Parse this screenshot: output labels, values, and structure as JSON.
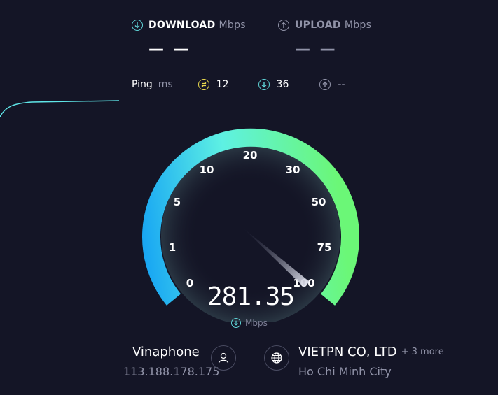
{
  "download": {
    "label": "DOWNLOAD",
    "unit": "Mbps",
    "value": "— —"
  },
  "upload": {
    "label": "UPLOAD",
    "unit": "Mbps",
    "value": "— —"
  },
  "ping": {
    "label": "Ping",
    "unit": "ms",
    "idle": "12",
    "download": "36",
    "upload": "--"
  },
  "gauge": {
    "ticks": [
      "0",
      "1",
      "5",
      "10",
      "20",
      "30",
      "50",
      "75",
      "100"
    ],
    "value": "281.35",
    "unit": "Mbps",
    "needle_level": 1.0
  },
  "isp": {
    "name": "Vinaphone",
    "ip": "113.188.178.175"
  },
  "server": {
    "name": "VIETPN CO, LTD",
    "more": "+ 3 more",
    "location": "Ho Chi Minh City"
  },
  "colors": {
    "background": "#141526",
    "gauge_start": "#19a7f3",
    "gauge_mid": "#5ef1e3",
    "gauge_end": "#6bf777",
    "ping_idle": "#e8d84d",
    "download_accent": "#5fd3d6",
    "muted": "#9193a8"
  }
}
